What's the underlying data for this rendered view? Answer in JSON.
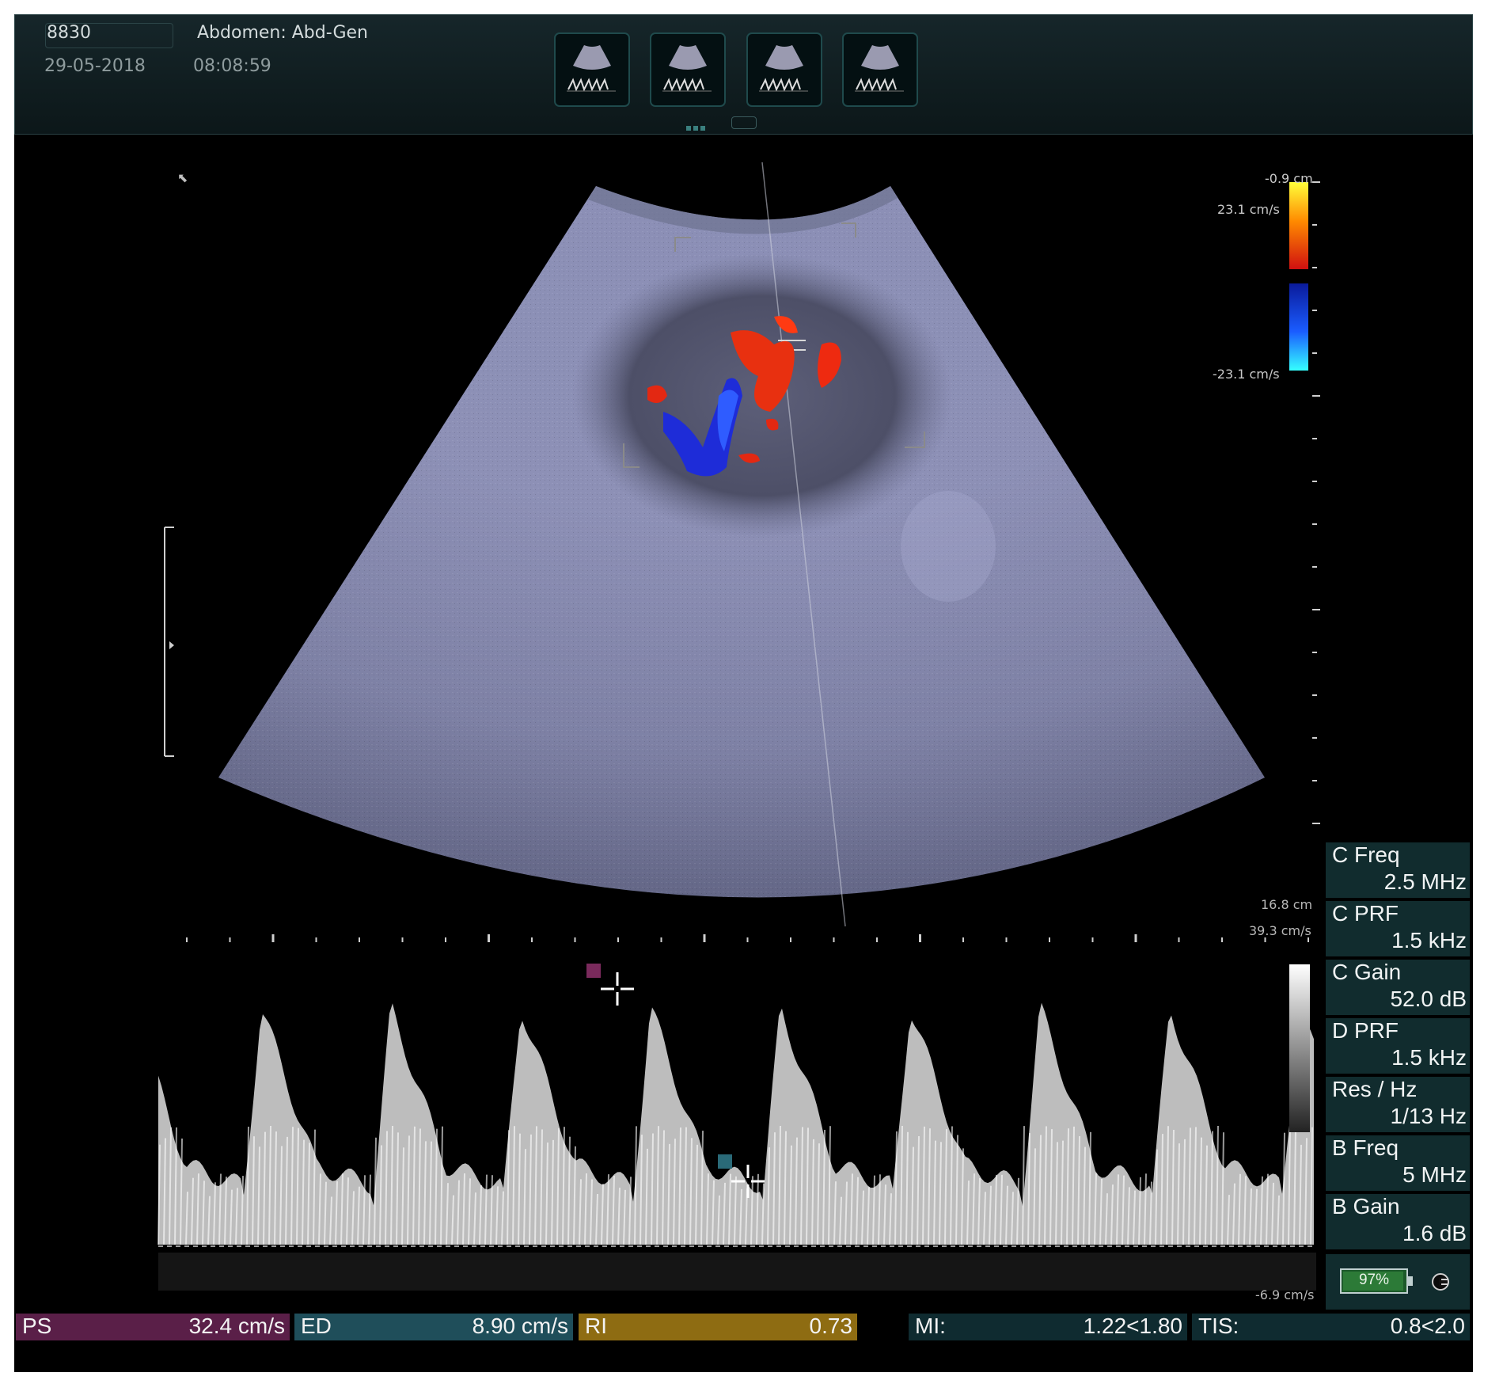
{
  "header": {
    "patient_id": "8830",
    "exam": "Abdomen: Abd-Gen",
    "date": "29-05-2018",
    "time": "08:08:59",
    "thumbnails": [
      "doppler-thumbnail-1",
      "doppler-thumbnail-2",
      "doppler-thumbnail-3",
      "doppler-thumbnail-4"
    ]
  },
  "color_scale": {
    "top_depth": "-0.9 cm",
    "max_velocity": "23.1 cm/s",
    "min_velocity": "-23.1 cm/s",
    "positive_colors": [
      "#ffff3a",
      "#ff8a00",
      "#e01010"
    ],
    "negative_colors": [
      "#0a1a9a",
      "#1a5cff",
      "#35ffff"
    ]
  },
  "depth_bottom": "16.8 cm",
  "spectral": {
    "max_velocity": "39.3 cm/s",
    "min_velocity": "-6.9 cm/s"
  },
  "params": [
    {
      "label": "C Freq",
      "value": "2.5 MHz"
    },
    {
      "label": "C PRF",
      "value": "1.5 kHz"
    },
    {
      "label": "C Gain",
      "value": "52.0 dB"
    },
    {
      "label": "D PRF",
      "value": "1.5 kHz"
    },
    {
      "label": "Res / Hz",
      "value": "1/13 Hz"
    },
    {
      "label": "B Freq",
      "value": "5 MHz"
    },
    {
      "label": "B Gain",
      "value": "1.6 dB"
    }
  ],
  "battery": {
    "text": "97%",
    "level": 0.97
  },
  "measurements": [
    {
      "label": "PS",
      "value": "32.4 cm/s",
      "color": "#5a1f48"
    },
    {
      "label": "ED",
      "value": "8.90 cm/s",
      "color": "#1f4e5a"
    },
    {
      "label": "RI",
      "value": "0.73",
      "color": "#8e6c12"
    },
    {
      "label": "MI:",
      "value": "1.22<1.80",
      "color": "#0f2b30"
    },
    {
      "label": "TIS:",
      "value": "0.8<2.0",
      "color": "#0f2b30"
    }
  ],
  "cursor_markers": {
    "ps_color": "#7a2a5c",
    "ed_color": "#2a6a78"
  }
}
